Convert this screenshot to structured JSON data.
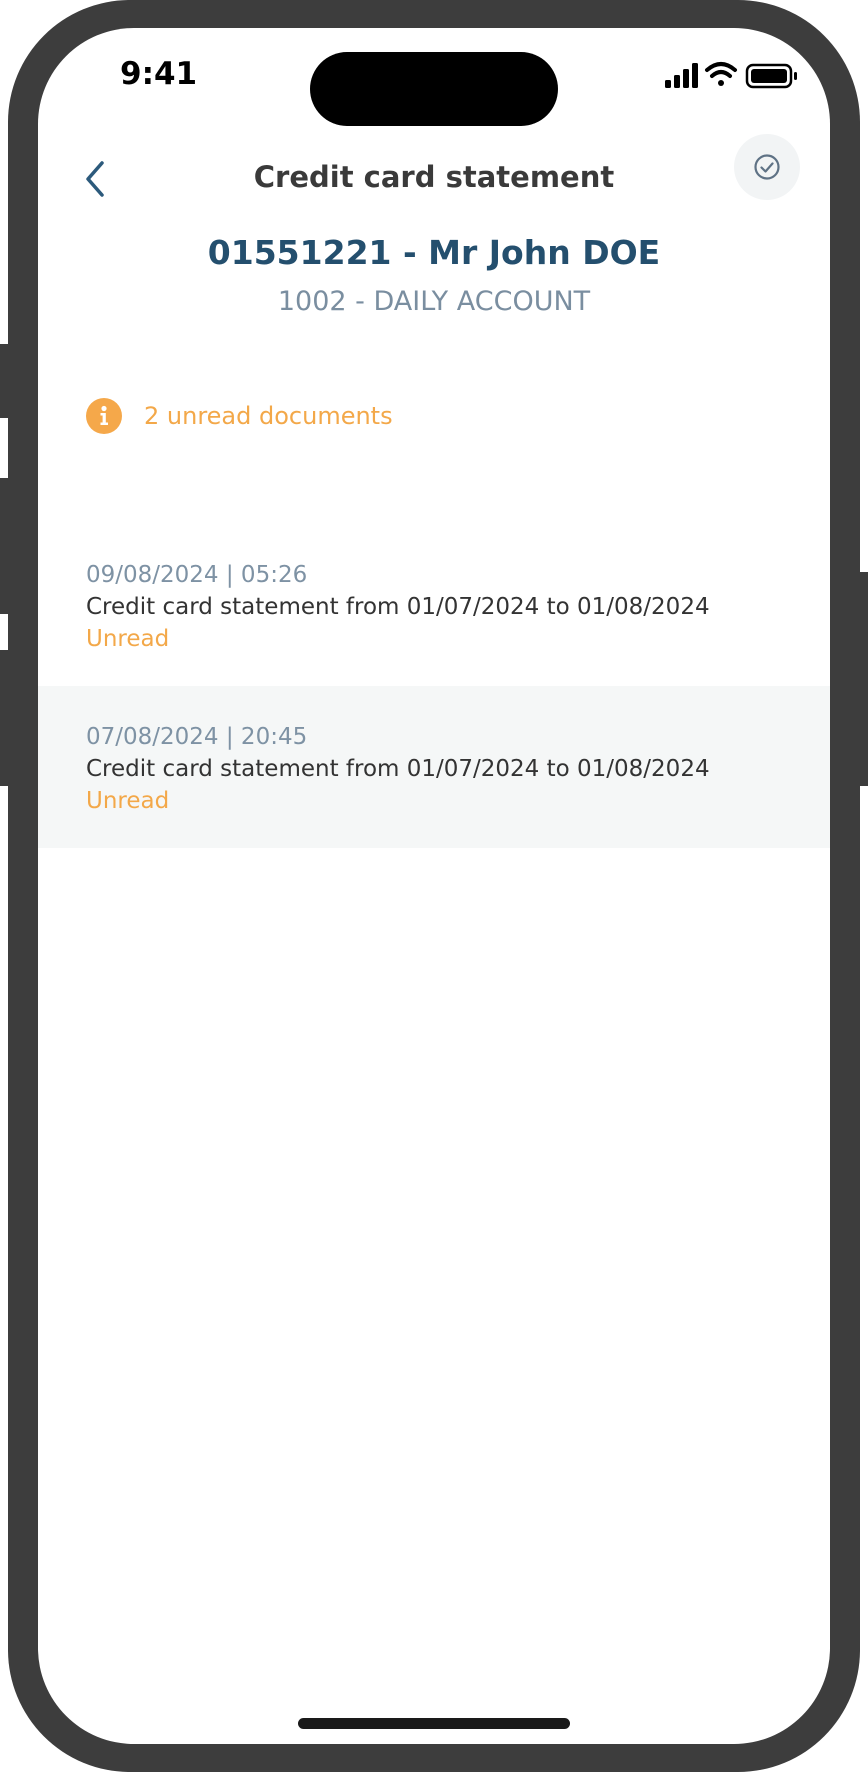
{
  "status_bar": {
    "time": "9:41"
  },
  "header": {
    "title": "Credit card statement",
    "back_icon": "chevron-left-icon",
    "action_icon": "check-circle-icon"
  },
  "account": {
    "id_line": "01551221 - Mr John DOE",
    "name_line": "1002 - DAILY ACCOUNT"
  },
  "notice": {
    "icon": "info-icon",
    "text": "2 unread documents"
  },
  "documents": [
    {
      "date": "09/08/2024 | 05:26",
      "title": "Credit card statement from 01/07/2024 to 01/08/2024",
      "status": "Unread"
    },
    {
      "date": "07/08/2024 | 20:45",
      "title": "Credit card statement from 01/07/2024 to 01/08/2024",
      "status": "Unread"
    }
  ],
  "colors": {
    "accent_orange": "#f3a849",
    "title_blue": "#244f6e",
    "muted_blue_gray": "#7a8ea0",
    "frame": "#3d3d3d"
  }
}
